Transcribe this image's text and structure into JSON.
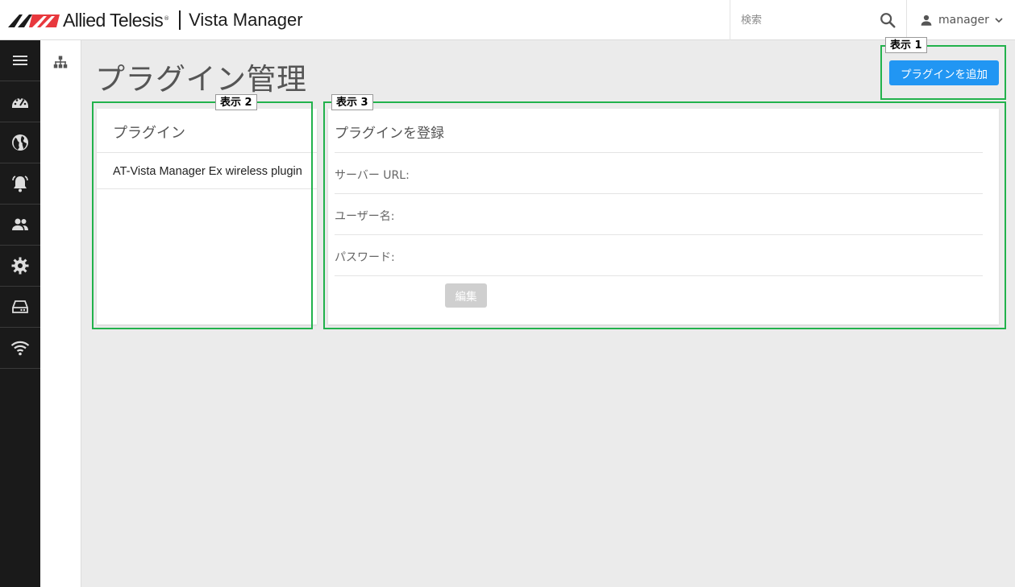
{
  "header": {
    "brand_name": "Allied Telesis",
    "brand_reg": "®",
    "product": "Vista Manager",
    "search_placeholder": "検索",
    "user_name": "manager"
  },
  "sidebar": {
    "items": [
      {
        "icon": "menu-icon"
      },
      {
        "icon": "dashboard-icon"
      },
      {
        "icon": "globe-icon"
      },
      {
        "icon": "alarm-bell-icon"
      },
      {
        "icon": "people-icon"
      },
      {
        "icon": "gear-icon"
      },
      {
        "icon": "storage-icon"
      },
      {
        "icon": "wifi-icon"
      }
    ]
  },
  "subnav": {
    "icon": "sitemap-icon"
  },
  "main": {
    "title": "プラグイン管理",
    "add_button": "プラグインを追加"
  },
  "plugin_list": {
    "title": "プラグイン",
    "items": [
      "AT-Vista Manager Ex wireless plugin"
    ]
  },
  "register": {
    "title": "プラグインを登録",
    "fields": [
      "サーバー URL:",
      "ユーザー名:",
      "パスワード:"
    ],
    "edit_button": "編集"
  },
  "annotations": [
    "表示 1",
    "表示 2",
    "表示 3"
  ],
  "colors": {
    "accent": "#2196f3",
    "annotation": "#22b24c",
    "sidebar": "#1a1a1a",
    "logo_red": "#e8383d"
  }
}
